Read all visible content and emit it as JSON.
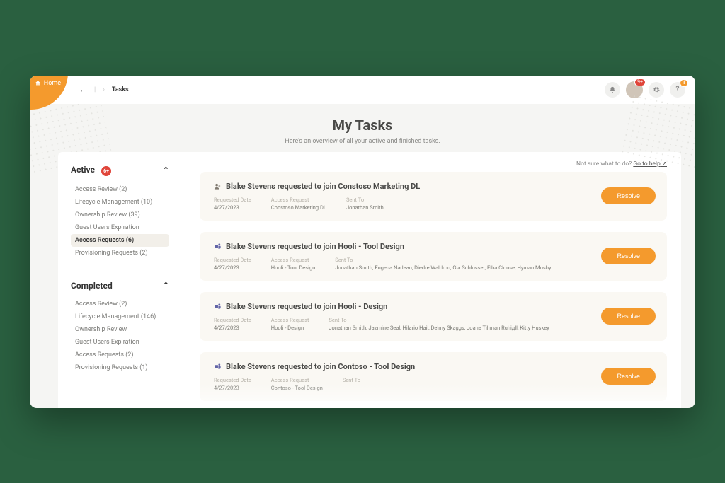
{
  "header": {
    "home_label": "Home",
    "breadcrumb_current": "Tasks",
    "notification_badge": "9+",
    "help_badge": "1"
  },
  "hero": {
    "title": "My Tasks",
    "subtitle": "Here's an overview of all your active and finished tasks."
  },
  "help_hint": {
    "text": "Not sure what to do?",
    "link": "Go to help"
  },
  "sidebar": {
    "active": {
      "title": "Active",
      "badge": "6+",
      "items": [
        {
          "label": "Access Review (2)"
        },
        {
          "label": "Lifecycle Management (10)"
        },
        {
          "label": "Ownership Review (39)"
        },
        {
          "label": "Guest Users Expiration"
        },
        {
          "label": "Access Requests (6)",
          "active": true
        },
        {
          "label": "Provisioning Requests (2)"
        }
      ]
    },
    "completed": {
      "title": "Completed",
      "items": [
        {
          "label": "Access Review (2)"
        },
        {
          "label": "Lifecycle Management (146)"
        },
        {
          "label": "Ownership Review"
        },
        {
          "label": "Guest Users Expiration"
        },
        {
          "label": "Access Requests (2)"
        },
        {
          "label": "Provisioning Requests (1)"
        }
      ]
    }
  },
  "labels": {
    "requested_date": "Requested Date",
    "access_request": "Access Request",
    "sent_to": "Sent To",
    "resolve": "Resolve"
  },
  "tasks": [
    {
      "icon": "person-add",
      "title": "Blake Stevens requested to join Constoso Marketing DL",
      "date": "4/27/2023",
      "request": "Constoso Marketing DL",
      "sent_to": "Jonathan Smith"
    },
    {
      "icon": "teams",
      "title": "Blake Stevens requested to join Hooli - Tool Design",
      "date": "4/27/2023",
      "request": "Hooli - Tool Design",
      "sent_to": "Jonathan Smith, Eugena Nadeau, Diedre Waldron, Gia Schlosser, Elba Clouse, Hyman Mosby"
    },
    {
      "icon": "teams",
      "title": "Blake Stevens requested to join Hooli - Design",
      "date": "4/27/2023",
      "request": "Hooli - Design",
      "sent_to": "Jonathan Smith, Jazmine Seal, Hilario Hail, Delmy Skaggs, Joane Tillman Ruhiдll, Kitty Huskey"
    },
    {
      "icon": "teams",
      "title": "Blake Stevens requested to join Contoso - Tool Design",
      "date": "4/27/2023",
      "request": "Contoso - Tool Design",
      "sent_to": ""
    }
  ]
}
